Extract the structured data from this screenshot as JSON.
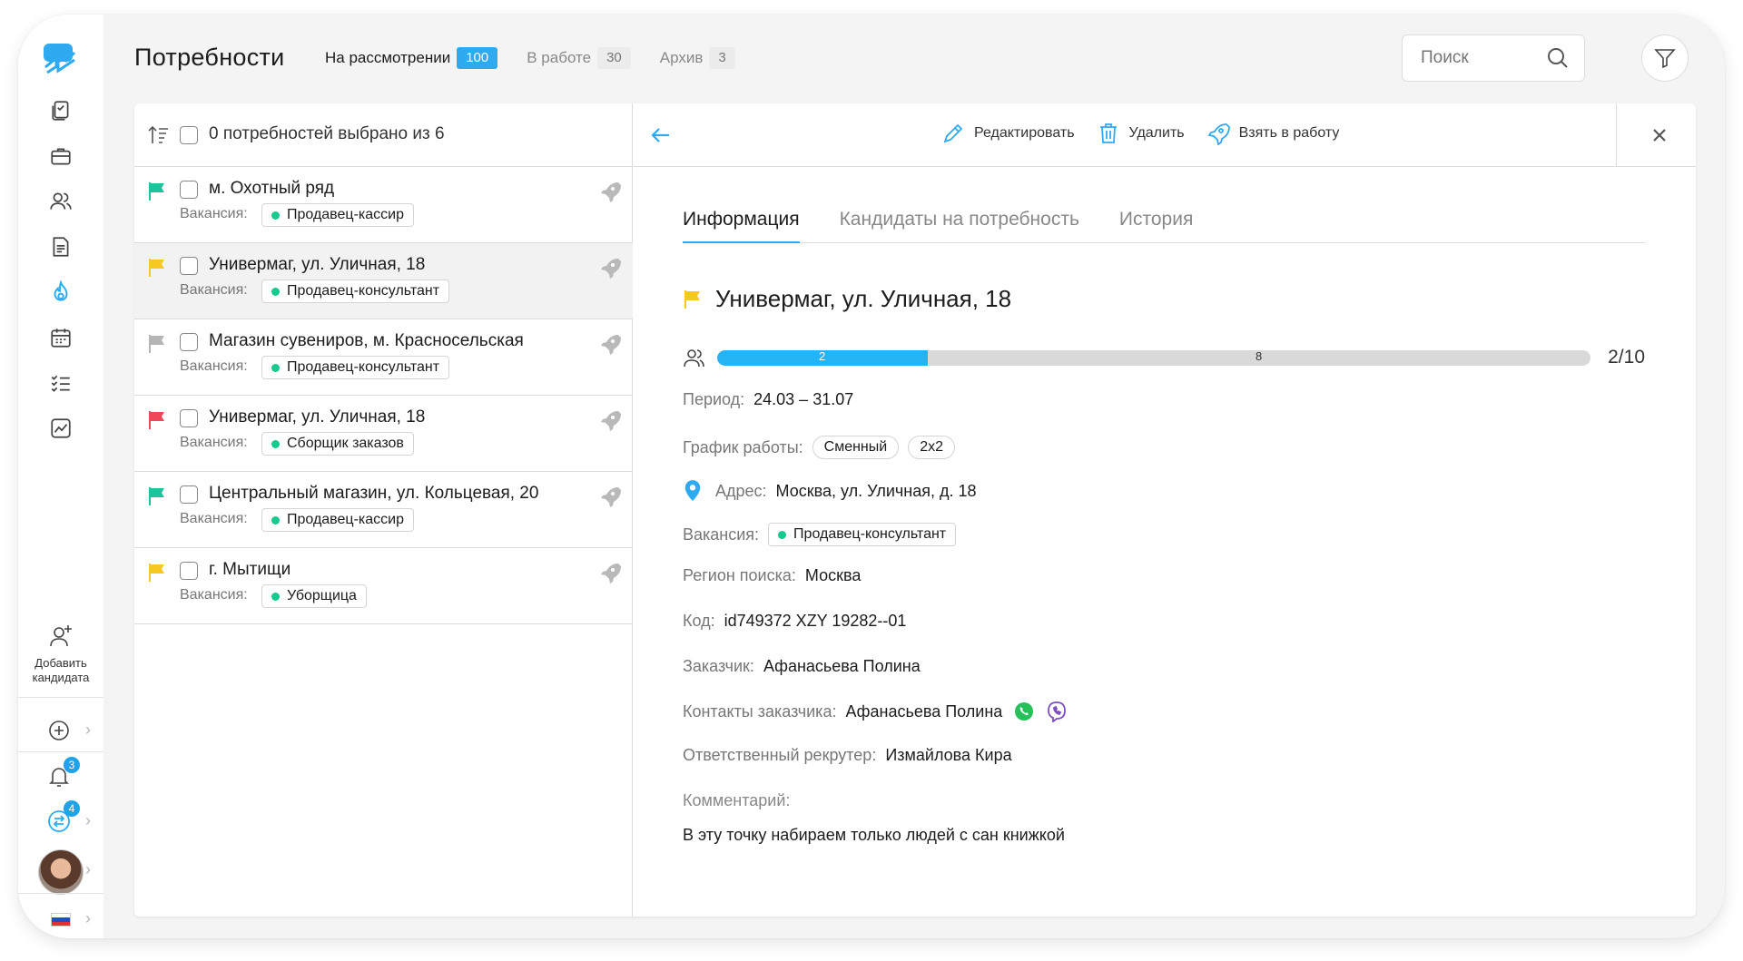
{
  "header": {
    "title": "Потребности",
    "tabs": [
      {
        "label": "На рассмотрении",
        "count": "100",
        "active": true
      },
      {
        "label": "В работе",
        "count": "30",
        "active": false
      },
      {
        "label": "Архив",
        "count": "3",
        "active": false
      }
    ],
    "search_placeholder": "Поиск"
  },
  "sidebar": {
    "icons": [
      "documents-icon",
      "briefcase-icon",
      "users-icon",
      "document-icon",
      "flame-icon",
      "calendar-icon",
      "checklist-icon",
      "chart-icon"
    ],
    "add_candidate_label": "Добавить кандидата",
    "notifications_count": "3",
    "messages_count": "4"
  },
  "list": {
    "selected_text": "0 потребностей выбрано из 6",
    "vacancy_label": "Вакансия:",
    "items": [
      {
        "title": "м. Охотный ряд",
        "vacancy": "Продавец-кассир",
        "flag_color": "#1bc49b"
      },
      {
        "title": "Универмаг, ул. Уличная, 18",
        "vacancy": "Продавец-консультант",
        "flag_color": "#f7c722"
      },
      {
        "title": "Магазин сувениров, м. Красносельская",
        "vacancy": "Продавец-консультант",
        "flag_color": "#b5b5b5"
      },
      {
        "title": "Универмаг, ул. Уличная, 18",
        "vacancy": "Сборщик заказов",
        "flag_color": "#f0465a"
      },
      {
        "title": "Центральный магазин, ул. Кольцевая, 20",
        "vacancy": "Продавец-кассир",
        "flag_color": "#1bc49b"
      },
      {
        "title": "г. Мытищи",
        "vacancy": "Уборщица",
        "flag_color": "#f7c722"
      }
    ]
  },
  "detail": {
    "actions": {
      "edit": "Редактировать",
      "delete": "Удалить",
      "take": "Взять в работу"
    },
    "tabs": [
      "Информация",
      "Кандидаты на потребность",
      "История"
    ],
    "title": "Универмаг, ул. Уличная, 18",
    "flag_color": "#f7c722",
    "progress": {
      "filled": "2",
      "remaining": "8",
      "ratio": "2/10",
      "fraction": 0.2
    },
    "period_label": "Период:",
    "period": "24.03 – 31.07",
    "schedule_label": "График работы:",
    "schedule": [
      "Сменный",
      "2x2"
    ],
    "address_label": "Адрес:",
    "address": "Москва, ул. Уличная, д. 18",
    "vacancy_label": "Вакансия:",
    "vacancy": "Продавец-консультант",
    "region_label": "Регион поиска:",
    "region": "Москва",
    "code_label": "Код:",
    "code": "id749372 XZY 19282--01",
    "customer_label": "Заказчик:",
    "customer": "Афанасьева Полина",
    "contacts_label": "Контакты заказчика:",
    "contacts": "Афанасьева Полина",
    "recruiter_label": "Ответственный рекрутер:",
    "recruiter": "Измайлова Кира",
    "comment_label": "Комментарий:",
    "comment": "В эту точку набираем только людей с сан книжкой"
  },
  "colors": {
    "accent": "#2eaaf0",
    "green": "#1bc49b",
    "yellow": "#f7c722",
    "red": "#f0465a"
  }
}
